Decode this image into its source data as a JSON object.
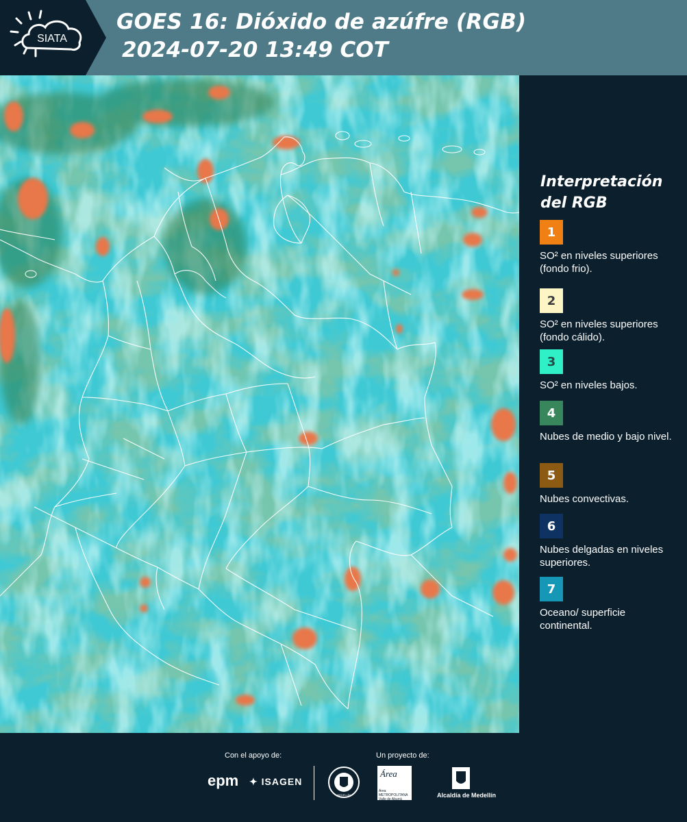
{
  "header": {
    "brand": "SIATA",
    "title_line1": "GOES 16: Dióxido de azúfre (RGB)",
    "title_line2": "2024-07-20 13:49 COT"
  },
  "legend": {
    "title": "Interpretación del RGB",
    "items": [
      {
        "number": "1",
        "color": "#f07f14",
        "number_color": "#ffffff",
        "label": "SO² en niveles superiores (fondo frio)."
      },
      {
        "number": "2",
        "color": "#fdf5c4",
        "number_color": "#3a3a3a",
        "label": "SO² en niveles superiores (fondo cálido)."
      },
      {
        "number": "3",
        "color": "#30f0c8",
        "number_color": "#1f4d47",
        "label": "SO² en niveles bajos."
      },
      {
        "number": "4",
        "color": "#37865c",
        "number_color": "#ffffff",
        "label": "Nubes de medio y bajo nivel."
      },
      {
        "number": "5",
        "color": "#8c5a12",
        "number_color": "#ffffff",
        "label": "Nubes convectivas."
      },
      {
        "number": "6",
        "color": "#0e3362",
        "number_color": "#ffffff",
        "label": "Nubes delgadas en niveles superiores."
      },
      {
        "number": "7",
        "color": "#1597b5",
        "number_color": "#ffffff",
        "label": "Oceano/ superficie continental."
      }
    ]
  },
  "footer": {
    "support_label": "Con el apoyo de:",
    "project_label": "Un proyecto de:",
    "sponsors": [
      "epm",
      "ISAGEN"
    ],
    "project_partners": [
      "MEDELLÍN",
      "Área METROPOLITANA Valle de Aburrá",
      "Alcaldía de Medellín"
    ]
  },
  "colors": {
    "header_bg": "#4f7b89",
    "panel_bg": "#0b1f2d",
    "map_base": "#3fc9d4",
    "map_cloud_green": "#2e8f6a",
    "map_convective": "#e8774a",
    "border_lines": "#ffffff"
  }
}
